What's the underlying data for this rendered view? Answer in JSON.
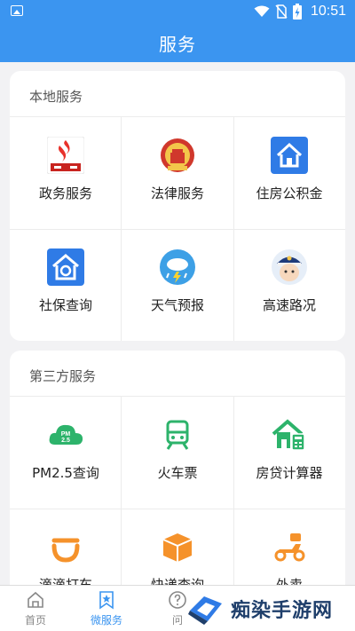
{
  "status_bar": {
    "time": "10:51"
  },
  "header": {
    "title": "服务"
  },
  "local_services": {
    "title": "本地服务",
    "items": [
      {
        "label": "政务服务",
        "icon": "government-service-icon"
      },
      {
        "label": "法律服务",
        "icon": "court-emblem-icon"
      },
      {
        "label": "住房公积金",
        "icon": "housing-fund-icon"
      },
      {
        "label": "社保查询",
        "icon": "social-security-icon"
      },
      {
        "label": "天气预报",
        "icon": "weather-icon"
      },
      {
        "label": "高速路况",
        "icon": "traffic-police-icon"
      }
    ]
  },
  "third_party_services": {
    "title": "第三方服务",
    "items": [
      {
        "label": "PM2.5查询",
        "icon": "pm25-cloud-icon"
      },
      {
        "label": "火车票",
        "icon": "train-icon"
      },
      {
        "label": "房贷计算器",
        "icon": "mortgage-calculator-icon"
      },
      {
        "label": "滴滴打车",
        "icon": "didi-icon"
      },
      {
        "label": "快递查询",
        "icon": "package-icon"
      },
      {
        "label": "外卖",
        "icon": "scooter-icon"
      }
    ]
  },
  "tab_bar": {
    "tabs": [
      {
        "label": "首页",
        "icon": "home-icon"
      },
      {
        "label": "微服务",
        "icon": "bookmark-star-icon",
        "active": true
      },
      {
        "label": "问",
        "icon": "question-icon"
      }
    ]
  },
  "watermark": {
    "text": "痴染手游网"
  },
  "colors": {
    "primary": "#3b95f0",
    "green": "#2db36b",
    "orange": "#f5922b"
  }
}
